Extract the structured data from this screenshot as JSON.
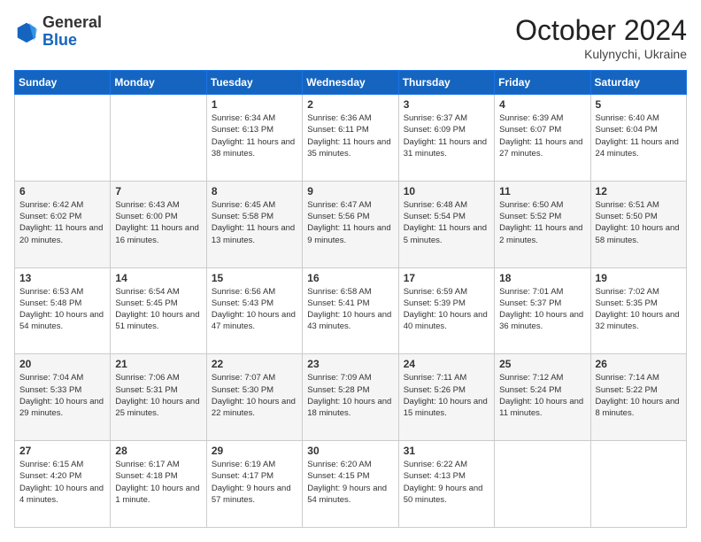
{
  "header": {
    "logo": {
      "line1": "General",
      "line2": "Blue"
    },
    "title": "October 2024",
    "subtitle": "Kulynychi, Ukraine"
  },
  "weekdays": [
    "Sunday",
    "Monday",
    "Tuesday",
    "Wednesday",
    "Thursday",
    "Friday",
    "Saturday"
  ],
  "weeks": [
    [
      null,
      null,
      {
        "day": "1",
        "sunrise": "Sunrise: 6:34 AM",
        "sunset": "Sunset: 6:13 PM",
        "daylight": "Daylight: 11 hours and 38 minutes."
      },
      {
        "day": "2",
        "sunrise": "Sunrise: 6:36 AM",
        "sunset": "Sunset: 6:11 PM",
        "daylight": "Daylight: 11 hours and 35 minutes."
      },
      {
        "day": "3",
        "sunrise": "Sunrise: 6:37 AM",
        "sunset": "Sunset: 6:09 PM",
        "daylight": "Daylight: 11 hours and 31 minutes."
      },
      {
        "day": "4",
        "sunrise": "Sunrise: 6:39 AM",
        "sunset": "Sunset: 6:07 PM",
        "daylight": "Daylight: 11 hours and 27 minutes."
      },
      {
        "day": "5",
        "sunrise": "Sunrise: 6:40 AM",
        "sunset": "Sunset: 6:04 PM",
        "daylight": "Daylight: 11 hours and 24 minutes."
      }
    ],
    [
      {
        "day": "6",
        "sunrise": "Sunrise: 6:42 AM",
        "sunset": "Sunset: 6:02 PM",
        "daylight": "Daylight: 11 hours and 20 minutes."
      },
      {
        "day": "7",
        "sunrise": "Sunrise: 6:43 AM",
        "sunset": "Sunset: 6:00 PM",
        "daylight": "Daylight: 11 hours and 16 minutes."
      },
      {
        "day": "8",
        "sunrise": "Sunrise: 6:45 AM",
        "sunset": "Sunset: 5:58 PM",
        "daylight": "Daylight: 11 hours and 13 minutes."
      },
      {
        "day": "9",
        "sunrise": "Sunrise: 6:47 AM",
        "sunset": "Sunset: 5:56 PM",
        "daylight": "Daylight: 11 hours and 9 minutes."
      },
      {
        "day": "10",
        "sunrise": "Sunrise: 6:48 AM",
        "sunset": "Sunset: 5:54 PM",
        "daylight": "Daylight: 11 hours and 5 minutes."
      },
      {
        "day": "11",
        "sunrise": "Sunrise: 6:50 AM",
        "sunset": "Sunset: 5:52 PM",
        "daylight": "Daylight: 11 hours and 2 minutes."
      },
      {
        "day": "12",
        "sunrise": "Sunrise: 6:51 AM",
        "sunset": "Sunset: 5:50 PM",
        "daylight": "Daylight: 10 hours and 58 minutes."
      }
    ],
    [
      {
        "day": "13",
        "sunrise": "Sunrise: 6:53 AM",
        "sunset": "Sunset: 5:48 PM",
        "daylight": "Daylight: 10 hours and 54 minutes."
      },
      {
        "day": "14",
        "sunrise": "Sunrise: 6:54 AM",
        "sunset": "Sunset: 5:45 PM",
        "daylight": "Daylight: 10 hours and 51 minutes."
      },
      {
        "day": "15",
        "sunrise": "Sunrise: 6:56 AM",
        "sunset": "Sunset: 5:43 PM",
        "daylight": "Daylight: 10 hours and 47 minutes."
      },
      {
        "day": "16",
        "sunrise": "Sunrise: 6:58 AM",
        "sunset": "Sunset: 5:41 PM",
        "daylight": "Daylight: 10 hours and 43 minutes."
      },
      {
        "day": "17",
        "sunrise": "Sunrise: 6:59 AM",
        "sunset": "Sunset: 5:39 PM",
        "daylight": "Daylight: 10 hours and 40 minutes."
      },
      {
        "day": "18",
        "sunrise": "Sunrise: 7:01 AM",
        "sunset": "Sunset: 5:37 PM",
        "daylight": "Daylight: 10 hours and 36 minutes."
      },
      {
        "day": "19",
        "sunrise": "Sunrise: 7:02 AM",
        "sunset": "Sunset: 5:35 PM",
        "daylight": "Daylight: 10 hours and 32 minutes."
      }
    ],
    [
      {
        "day": "20",
        "sunrise": "Sunrise: 7:04 AM",
        "sunset": "Sunset: 5:33 PM",
        "daylight": "Daylight: 10 hours and 29 minutes."
      },
      {
        "day": "21",
        "sunrise": "Sunrise: 7:06 AM",
        "sunset": "Sunset: 5:31 PM",
        "daylight": "Daylight: 10 hours and 25 minutes."
      },
      {
        "day": "22",
        "sunrise": "Sunrise: 7:07 AM",
        "sunset": "Sunset: 5:30 PM",
        "daylight": "Daylight: 10 hours and 22 minutes."
      },
      {
        "day": "23",
        "sunrise": "Sunrise: 7:09 AM",
        "sunset": "Sunset: 5:28 PM",
        "daylight": "Daylight: 10 hours and 18 minutes."
      },
      {
        "day": "24",
        "sunrise": "Sunrise: 7:11 AM",
        "sunset": "Sunset: 5:26 PM",
        "daylight": "Daylight: 10 hours and 15 minutes."
      },
      {
        "day": "25",
        "sunrise": "Sunrise: 7:12 AM",
        "sunset": "Sunset: 5:24 PM",
        "daylight": "Daylight: 10 hours and 11 minutes."
      },
      {
        "day": "26",
        "sunrise": "Sunrise: 7:14 AM",
        "sunset": "Sunset: 5:22 PM",
        "daylight": "Daylight: 10 hours and 8 minutes."
      }
    ],
    [
      {
        "day": "27",
        "sunrise": "Sunrise: 6:15 AM",
        "sunset": "Sunset: 4:20 PM",
        "daylight": "Daylight: 10 hours and 4 minutes."
      },
      {
        "day": "28",
        "sunrise": "Sunrise: 6:17 AM",
        "sunset": "Sunset: 4:18 PM",
        "daylight": "Daylight: 10 hours and 1 minute."
      },
      {
        "day": "29",
        "sunrise": "Sunrise: 6:19 AM",
        "sunset": "Sunset: 4:17 PM",
        "daylight": "Daylight: 9 hours and 57 minutes."
      },
      {
        "day": "30",
        "sunrise": "Sunrise: 6:20 AM",
        "sunset": "Sunset: 4:15 PM",
        "daylight": "Daylight: 9 hours and 54 minutes."
      },
      {
        "day": "31",
        "sunrise": "Sunrise: 6:22 AM",
        "sunset": "Sunset: 4:13 PM",
        "daylight": "Daylight: 9 hours and 50 minutes."
      },
      null,
      null
    ]
  ]
}
